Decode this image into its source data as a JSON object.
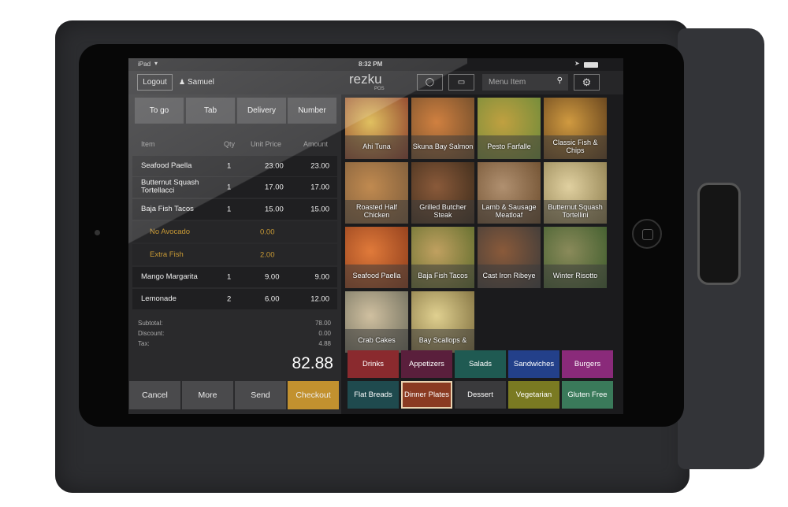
{
  "status": {
    "device": "iPad",
    "time": "8:32 PM"
  },
  "header": {
    "logout": "Logout",
    "user": "Samuel",
    "brand": "rezku",
    "brand_sub": "POS",
    "search_placeholder": "Menu Item"
  },
  "order_types": [
    "To go",
    "Tab",
    "Delivery",
    "Number"
  ],
  "columns": {
    "item": "Item",
    "qty": "Qty",
    "unit_price": "Unit Price",
    "amount": "Amount"
  },
  "order_items": [
    {
      "name": "Seafood Paella",
      "qty": "1",
      "price": "23.00",
      "amount": "23.00"
    },
    {
      "name": "Butternut Squash Tortellacci",
      "qty": "1",
      "price": "17.00",
      "amount": "17.00"
    },
    {
      "name": "Baja Fish Tacos",
      "qty": "1",
      "price": "15.00",
      "amount": "15.00"
    },
    {
      "name": "No Avocado",
      "qty": "",
      "price": "0.00",
      "amount": "",
      "modifier": true
    },
    {
      "name": "Extra Fish",
      "qty": "",
      "price": "2.00",
      "amount": "",
      "modifier": true
    },
    {
      "name": "Mango Margarita",
      "qty": "1",
      "price": "9.00",
      "amount": "9.00"
    },
    {
      "name": "Lemonade",
      "qty": "2",
      "price": "6.00",
      "amount": "12.00"
    }
  ],
  "totals": {
    "subtotal_label": "Subtotal:",
    "subtotal": "78.00",
    "discount_label": "Discount:",
    "discount": "0.00",
    "tax_label": "Tax:",
    "tax": "4.88",
    "total": "82.88"
  },
  "actions": [
    "Cancel",
    "More",
    "Send",
    "Checkout"
  ],
  "menu_items": [
    "Ahi Tuna",
    "Skuna Bay Salmon",
    "Pesto Farfalle",
    "Classic Fish & Chips",
    "Roasted Half Chicken",
    "Grilled Butcher Steak",
    "Lamb & Sausage Meatloaf",
    "Butternut Squash Tortellini",
    "Seafood Paella",
    "Baja Fish Tacos",
    "Cast Iron Ribeye",
    "Winter Risotto",
    "Crab Cakes",
    "Bay Scallops &"
  ],
  "categories": [
    {
      "label": "Drinks",
      "color": "#8a2a2e"
    },
    {
      "label": "Appetizers",
      "color": "#5a1f3c"
    },
    {
      "label": "Salads",
      "color": "#1f5a52"
    },
    {
      "label": "Sandwiches",
      "color": "#23408a"
    },
    {
      "label": "Burgers",
      "color": "#8a2a7a"
    },
    {
      "label": "Flat Breads",
      "color": "#1f4a4e"
    },
    {
      "label": "Dinner Plates",
      "color": "#8a3a22",
      "selected": true
    },
    {
      "label": "Dessert",
      "color": "#3a3a3c"
    },
    {
      "label": "Vegetarian",
      "color": "#7a7a22"
    },
    {
      "label": "Gluten Free",
      "color": "#3a7a5a"
    }
  ],
  "colors": {
    "accent": "#c2912f",
    "modifier": "#c99a35"
  }
}
